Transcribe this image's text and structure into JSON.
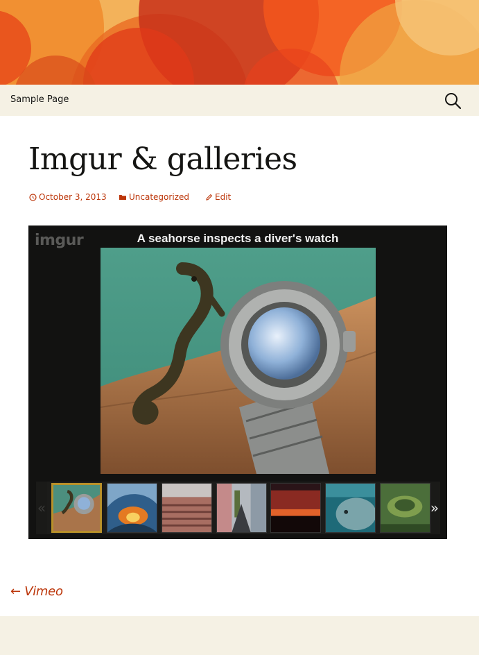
{
  "navigation": {
    "menu_item": "Sample Page"
  },
  "post": {
    "title": "Imgur & galleries",
    "date": "October 3, 2013",
    "category": "Uncategorized",
    "edit_label": "Edit"
  },
  "embed": {
    "logo": "imgur",
    "caption": "A seahorse inspects a diver's watch",
    "prev_arrow": "«",
    "next_arrow": "»",
    "thumbnails": [
      {
        "name": "seahorse-watch",
        "active": true
      },
      {
        "name": "wave-tunnel",
        "active": false
      },
      {
        "name": "field-rows",
        "active": false
      },
      {
        "name": "street-buildings",
        "active": false
      },
      {
        "name": "sunset-sky",
        "active": false
      },
      {
        "name": "whale-underwater",
        "active": false
      },
      {
        "name": "green-crater",
        "active": false
      }
    ]
  },
  "post_navigation": {
    "previous_arrow": "←",
    "previous_title": "Vimeo"
  },
  "colors": {
    "accent": "#bc360a",
    "background": "#f5f1e4",
    "embed_background": "#121211",
    "active_thumb_border": "#b8902a"
  }
}
